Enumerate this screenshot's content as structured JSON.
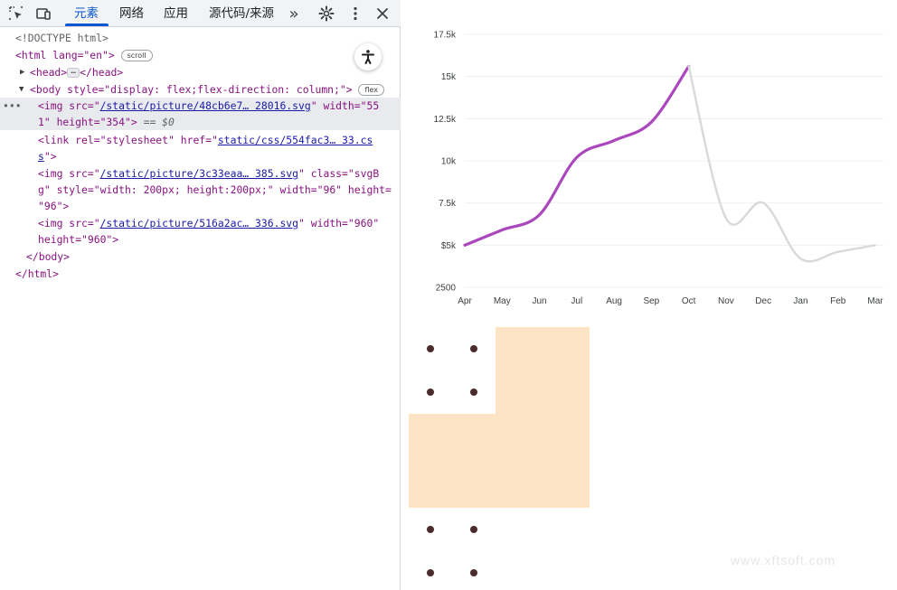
{
  "toolbar": {
    "tabs": [
      {
        "label": "元素",
        "active": true
      },
      {
        "label": "网络",
        "active": false
      },
      {
        "label": "应用",
        "active": false
      },
      {
        "label": "源代码/来源",
        "active": false
      }
    ],
    "more_label": "»"
  },
  "code": {
    "doctype": "<!DOCTYPE html>",
    "html_open": "<html lang=\"en\">",
    "scroll_badge": "scroll",
    "head_open": "<head>",
    "head_dots": "…",
    "head_close": "</head>",
    "body_open": "<body style=\"display: flex;flex-direction: column;\">",
    "flex_badge": "flex",
    "selected_prefix": "•••",
    "img1_a": "<img src=\"",
    "img1_link": "/static/picture/48cb6e7… 28016.svg",
    "img1_b": "\" width=\"55",
    "img1_c": "1\" height=\"354\">",
    "img1_eq": " == $0",
    "link_a": "<link rel=\"stylesheet\" href=\"",
    "link_link": "static/css/554fac3… 33.cs",
    "link_c_link": "s",
    "link_c_rest": "\">",
    "img2_a": "<img src=\"",
    "img2_link": "/static/picture/3c33eaa… 385.svg",
    "img2_b": "\" class=\"svgB",
    "img2_c": "g\" style=\"width: 200px; height:200px;\" width=\"96\" height=",
    "img2_d": "\"96\">",
    "img3_a": "<img src=\"",
    "img3_link": "/static/picture/516a2ac… 336.svg",
    "img3_b": "\" width=\"960\"",
    "img3_c": "height=\"960\">",
    "body_close": "</body>",
    "html_close": "</html>"
  },
  "watermark": "www.xftsoft.com",
  "colors": {
    "solid_line": "#ab47bc",
    "dashed_line": "#d9d9d9",
    "peach": "#fde4c4",
    "dot": "#4a2c2c",
    "accent": "#0b57d0"
  },
  "chart_data": {
    "type": "line",
    "categories": [
      "Apr",
      "May",
      "Jun",
      "Jul",
      "Aug",
      "Sep",
      "Oct",
      "Nov",
      "Dec",
      "Jan",
      "Feb",
      "Mar"
    ],
    "series": [
      {
        "values": [
          5000,
          5900,
          6800,
          10200,
          11200,
          12300,
          15600,
          null,
          null,
          null,
          null,
          null
        ]
      },
      {
        "values": [
          null,
          null,
          null,
          null,
          null,
          null,
          15600,
          6600,
          7500,
          4200,
          4600,
          5000
        ]
      }
    ],
    "yticks": [
      "2500",
      "$5k",
      "7.5k",
      "10k",
      "12.5k",
      "15k",
      "17.5k"
    ],
    "ytick_values": [
      2500,
      5000,
      7500,
      10000,
      12500,
      15000,
      17500
    ],
    "ylim": [
      2500,
      17500
    ]
  }
}
